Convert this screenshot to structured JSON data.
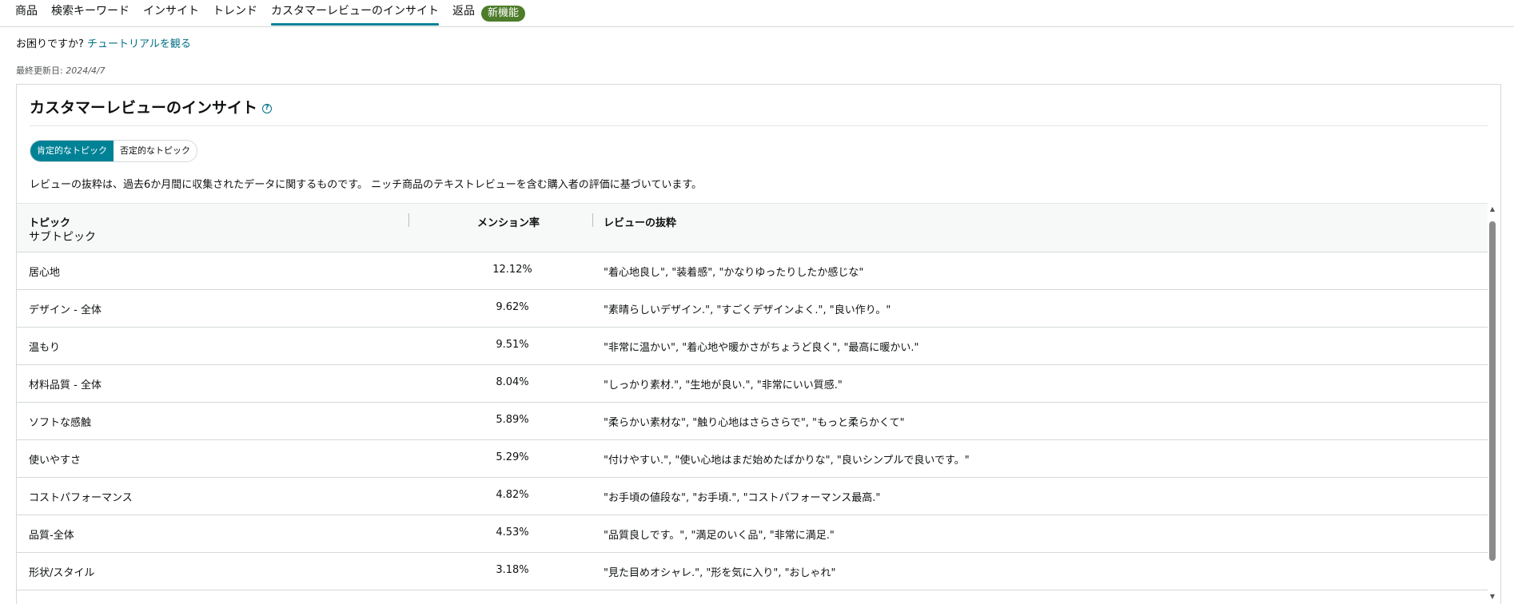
{
  "tabs": [
    {
      "label": "商品"
    },
    {
      "label": "検索キーワード"
    },
    {
      "label": "インサイト"
    },
    {
      "label": "トレンド"
    },
    {
      "label": "カスタマーレビューのインサイト"
    },
    {
      "label": "返品"
    }
  ],
  "new_badge": "新機能",
  "help": {
    "question": "お困りですか? ",
    "link": "チュートリアルを観る"
  },
  "updated": {
    "label": "最終更新日: ",
    "date": "2024/4/7"
  },
  "panel": {
    "title": "カスタマーレビューのインサイト",
    "toggle": {
      "positive": "肯定的なトピック",
      "negative": "否定的なトピック"
    },
    "note": "レビューの抜粋は、過去6か月間に収集されたデータに関するものです。 ニッチ商品のテキストレビューを含む購入者の評価に基づいています。"
  },
  "table": {
    "headers": {
      "topic": "トピック",
      "subtopic": "サブトピック",
      "rate": "メンション率",
      "excerpt": "レビューの抜粋"
    },
    "rows": [
      {
        "topic": "居心地",
        "rate": "12.12%",
        "excerpt": "\"着心地良し\", \"装着感\", \"かなりゆったりしたか感じな\""
      },
      {
        "topic": "デザイン - 全体",
        "rate": "9.62%",
        "excerpt": "\"素晴らしいデザイン.\", \"すごくデザインよく.\", \"良い作り。\""
      },
      {
        "topic": "温もり",
        "rate": "9.51%",
        "excerpt": "\"非常に温かい\", \"着心地や暖かさがちょうど良く\", \"最高に暖かい.\""
      },
      {
        "topic": "材料品質 - 全体",
        "rate": "8.04%",
        "excerpt": "\"しっかり素材.\", \"生地が良い.\", \"非常にいい質感.\""
      },
      {
        "topic": "ソフトな感触",
        "rate": "5.89%",
        "excerpt": "\"柔らかい素材な\", \"触り心地はさらさらで\", \"もっと柔らかくて\""
      },
      {
        "topic": "使いやすさ",
        "rate": "5.29%",
        "excerpt": "\"付けやすい.\", \"使い心地はまだ始めたばかりな\", \"良いシンプルで良いです。\""
      },
      {
        "topic": "コストパフォーマンス",
        "rate": "4.82%",
        "excerpt": "\"お手頃の値段な\", \"お手頃.\", \"コストパフォーマンス最高.\""
      },
      {
        "topic": "品質-全体",
        "rate": "4.53%",
        "excerpt": "\"品質良しです。\", \"満足のいく品\", \"非常に満足.\""
      },
      {
        "topic": "形状/スタイル",
        "rate": "3.18%",
        "excerpt": "\"見た目めオシャレ.\", \"形を気に入り\", \"おしゃれ\""
      }
    ]
  },
  "colors": {
    "accent": "#008296",
    "link": "#007185",
    "badge": "#4d7c2a"
  }
}
